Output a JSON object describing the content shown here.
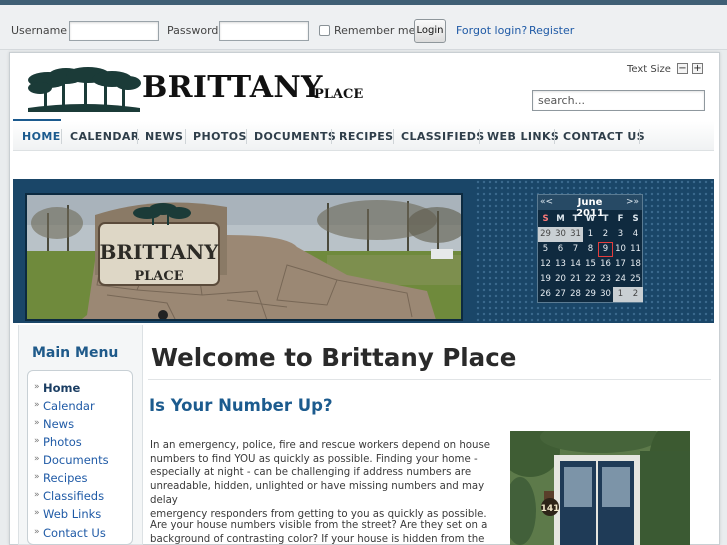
{
  "login": {
    "username_label": "Username",
    "password_label": "Password",
    "remember_label": "Remember me",
    "login_button": "Login",
    "forgot_link": "Forgot login?",
    "register_link": "Register"
  },
  "header": {
    "brand_main": "BRITTANY",
    "brand_sub": "PLACE",
    "text_size_label": "Text Size",
    "decrease_glyph": "−",
    "increase_glyph": "+",
    "search_placeholder": "search..."
  },
  "nav": {
    "items": [
      "HOME",
      "CALENDAR",
      "NEWS",
      "PHOTOS",
      "DOCUMENTS",
      "RECIPES",
      "CLASSIFIEDS",
      "WEB LINKS",
      "CONTACT US"
    ],
    "active": "HOME"
  },
  "calendar": {
    "prev": "«<",
    "next": ">»",
    "month": "June 2011",
    "dow": [
      "S",
      "M",
      "T",
      "W",
      "T",
      "F",
      "S"
    ],
    "weeks": [
      [
        "29",
        "30",
        "31",
        "1",
        "2",
        "3",
        "4"
      ],
      [
        "5",
        "6",
        "7",
        "8",
        "9",
        "10",
        "11"
      ],
      [
        "12",
        "13",
        "14",
        "15",
        "16",
        "17",
        "18"
      ],
      [
        "19",
        "20",
        "21",
        "22",
        "23",
        "24",
        "25"
      ],
      [
        "26",
        "27",
        "28",
        "29",
        "30",
        "1",
        "2"
      ]
    ],
    "today": "9"
  },
  "banner": {
    "sign_main": "BRITTANY",
    "sign_sub": "PLACE"
  },
  "sidebar": {
    "title": "Main Menu",
    "items": [
      "Home",
      "Calendar",
      "News",
      "Photos",
      "Documents",
      "Recipes",
      "Classifieds",
      "Web Links",
      "Contact Us"
    ],
    "active": "Home"
  },
  "main": {
    "title": "Welcome to Brittany Place",
    "subtitle": "Is Your Number Up?",
    "p1_lines": [
      "In an emergency, police, fire and rescue workers depend on house",
      "numbers to find YOU as quickly as possible. Finding your home -",
      "especially at night - can be challenging if address numbers are",
      "unreadable, hidden, unlighted or have missing numbers and may delay",
      "emergency responders from getting to you as quickly as possible."
    ],
    "p2_lines": [
      "Are your house numbers visible from the street? Are they set on a",
      "background of contrasting color? If your house is hidden from the street,"
    ],
    "door_number": "141"
  },
  "colors": {
    "accent": "#1b5a8e",
    "link": "#1f5aa6",
    "banner_bg": "#1a4668"
  }
}
